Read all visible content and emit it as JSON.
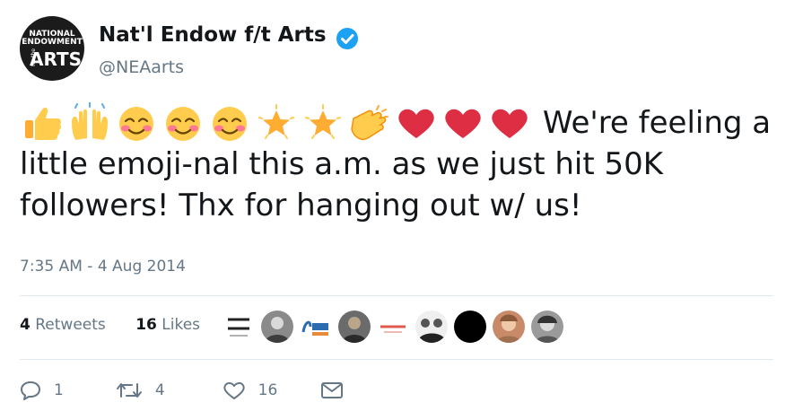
{
  "account": {
    "display_name": "Nat'l Endow f/t Arts",
    "handle": "@NEAarts",
    "avatar_text": [
      "NATIONAL",
      "ENDOWMENT",
      "for the",
      "ARTS"
    ]
  },
  "tweet": {
    "emojis": [
      "thumbs-up",
      "raised-hands",
      "smiling-face",
      "smiling-face",
      "smiling-face",
      "star",
      "star",
      "clapping-hands",
      "heart",
      "heart",
      "heart"
    ],
    "text": "We're feeling a little emoji-nal this a.m. as we just hit 50K followers! Thx for hanging out w/ us!",
    "timestamp": "7:35 AM - 4 Aug 2014"
  },
  "stats": {
    "retweets_count": "4",
    "retweets_label": "Retweets",
    "likes_count": "16",
    "likes_label": "Likes"
  },
  "likers": [
    "spark-media",
    "photo",
    "30-years-logo",
    "photo",
    "red-logo",
    "photo",
    "black-circle",
    "photo",
    "photo"
  ],
  "actions": {
    "reply_count": "1",
    "retweet_count": "4",
    "like_count": "16"
  },
  "colors": {
    "verified": "#1da1f2",
    "secondary": "#657786",
    "heart": "#dd2e44"
  }
}
